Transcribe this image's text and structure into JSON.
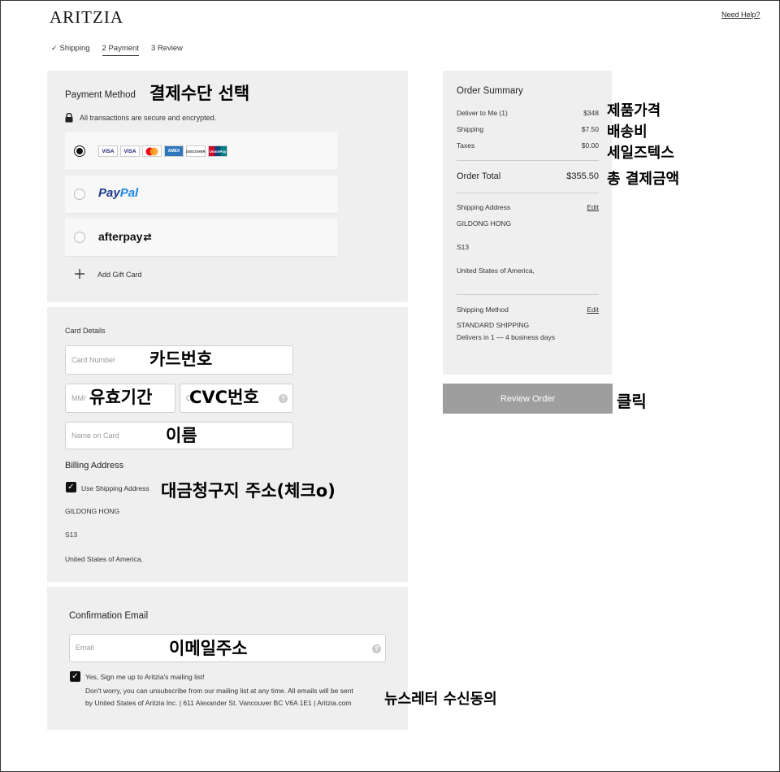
{
  "header": {
    "logo": "ARITZIA",
    "need_help": "Need Help?"
  },
  "steps": [
    {
      "label": "Shipping",
      "completed": true
    },
    {
      "label": "2 Payment",
      "active": true
    },
    {
      "label": "3 Review"
    }
  ],
  "payment_method": {
    "title": "Payment Method",
    "secure_text": "All transactions are secure and encrypted.",
    "card_logos": [
      "VISA",
      "VISA",
      "MC",
      "AMEX",
      "DISCOVER",
      "UnionPay"
    ],
    "paypal": {
      "pay": "Pay",
      "pal": "Pal"
    },
    "afterpay": "afterpay",
    "add_gift_card": "Add Gift Card",
    "annotation": "결제수단 선택"
  },
  "card_details": {
    "title": "Card Details",
    "card_number_placeholder": "Card Number",
    "expiry_placeholder": "MM/",
    "cvc_placeholder": "C",
    "name_placeholder": "Name on Card",
    "billing_title": "Billing Address",
    "use_shipping_label": "Use Shipping Address",
    "billing_name": "GILDONG HONG",
    "billing_line": "S13",
    "billing_country": "United States of America,",
    "annotations": {
      "card_number": "카드번호",
      "expiry": "유효기간",
      "cvc": "CVC번호",
      "name": "이름",
      "billing": "대금청구지 주소(체크o)"
    }
  },
  "confirmation": {
    "title": "Confirmation Email",
    "email_placeholder": "Email",
    "signup_label": "Yes, Sign me up to Aritzia's mailing list!",
    "disclaimer_1": "Don't worry, you can unsubscribe from our mailing list at any time. All emails will be sent",
    "disclaimer_2": "by United States of Aritzia Inc. | 611 Alexander St. Vancouver BC V6A 1E1 | Aritzia.com",
    "annotations": {
      "email": "이메일주소",
      "newsletter": "뉴스레터 수신동의"
    }
  },
  "order_summary": {
    "title": "Order Summary",
    "rows": [
      {
        "label": "Deliver to Me (1)",
        "value": "$348"
      },
      {
        "label": "Shipping",
        "value": "$7.50"
      },
      {
        "label": "Taxes",
        "value": "$0.00"
      }
    ],
    "total_label": "Order Total",
    "total_value": "$355.50",
    "shipping_address_label": "Shipping Address",
    "edit": "Edit",
    "ship_name": "GILDONG HONG",
    "ship_line": "S13",
    "ship_country": "United States of America,",
    "shipping_method_label": "Shipping Method",
    "method_name": "STANDARD SHIPPING",
    "method_eta": "Delivers in 1 — 4 business days",
    "review_button": "Review Order",
    "annotations": {
      "product_price": "제품가격",
      "shipping_fee": "배송비",
      "sales_tax": "세일즈텍스",
      "total": "총 결제금액",
      "click": "클릭"
    }
  }
}
